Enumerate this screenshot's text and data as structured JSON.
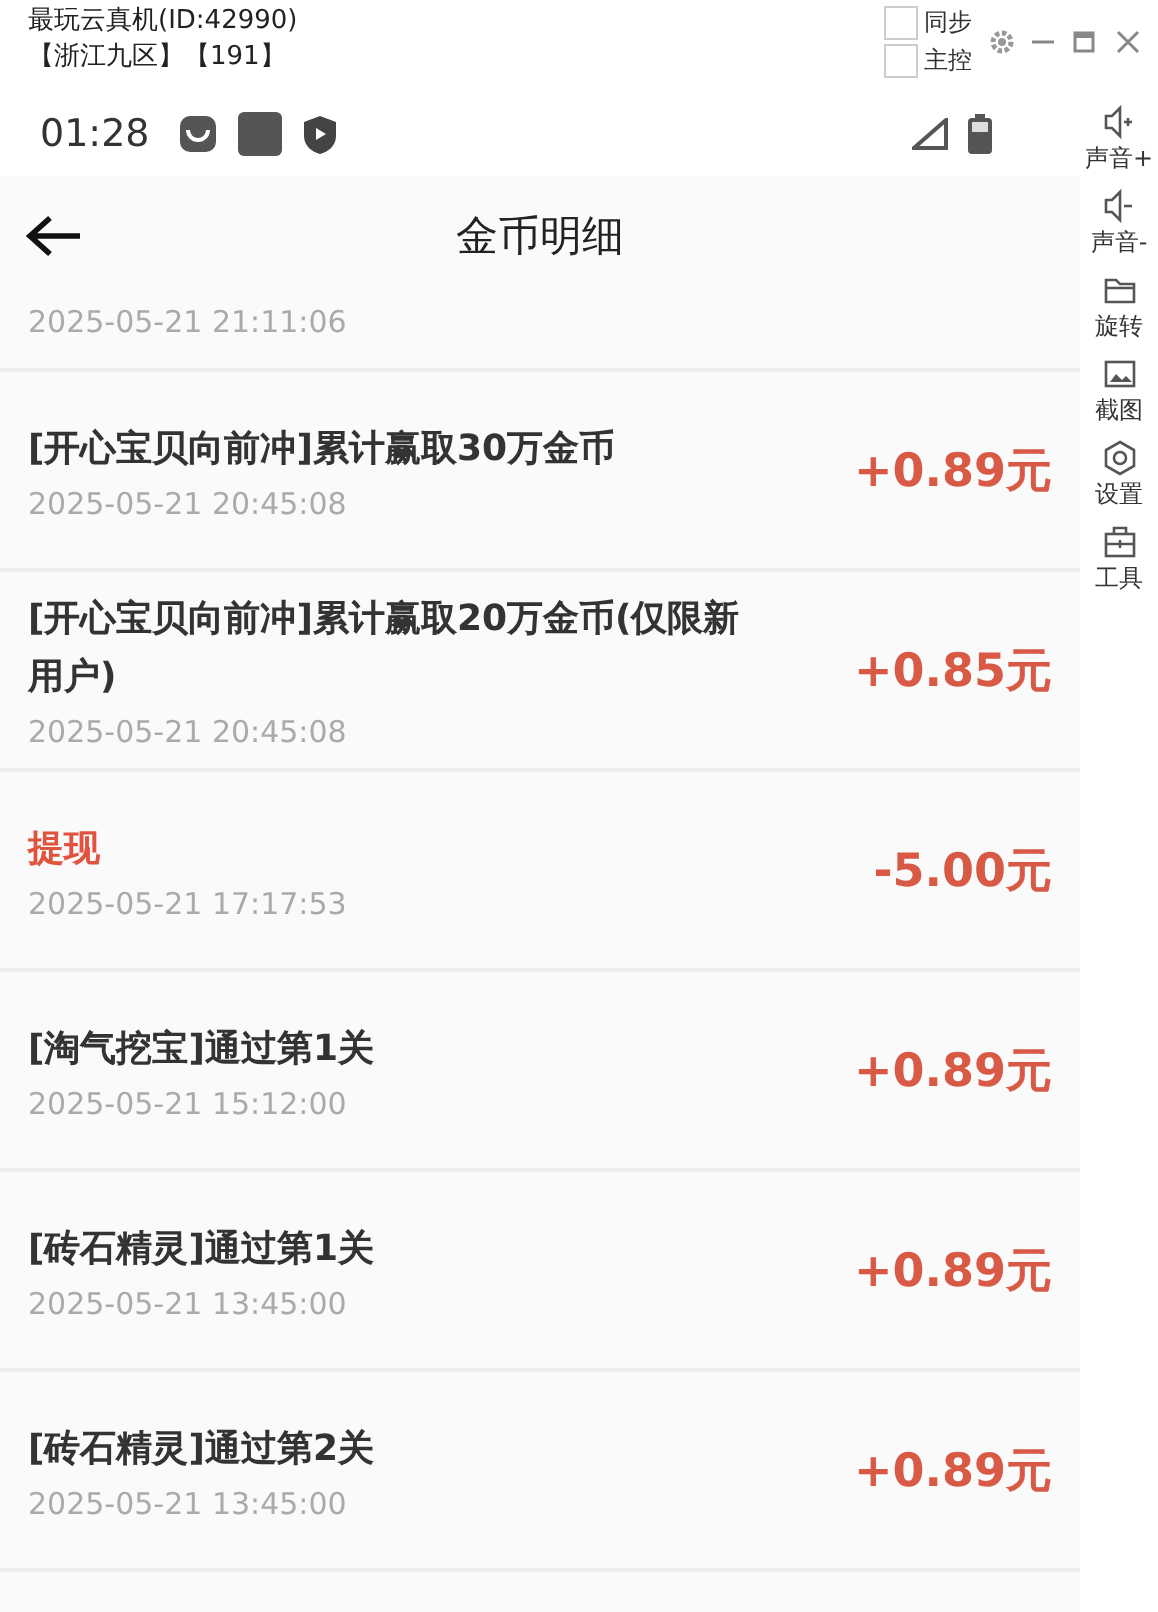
{
  "window": {
    "title": "最玩云真机(ID:42990)",
    "subtitle": "【浙江九区】【191】",
    "options": [
      {
        "label": "同步",
        "checked": false
      },
      {
        "label": "主控",
        "checked": false
      }
    ]
  },
  "status_bar": {
    "time": "01:28"
  },
  "header": {
    "title": "金币明细"
  },
  "records": [
    {
      "kind": "partial",
      "time": "2025-05-21 21:11:06"
    },
    {
      "kind": "income",
      "title": "[开心宝贝向前冲]累计赢取30万金币",
      "time": "2025-05-21 20:45:08",
      "amount": "+0.89元"
    },
    {
      "kind": "income",
      "title": "[开心宝贝向前冲]累计赢取20万金币(仅限新用户)",
      "time": "2025-05-21 20:45:08",
      "amount": "+0.85元"
    },
    {
      "kind": "withdrawal",
      "title": "提现",
      "time": "2025-05-21 17:17:53",
      "amount": "-5.00元"
    },
    {
      "kind": "income",
      "title": "[淘气挖宝]通过第1关",
      "time": "2025-05-21 15:12:00",
      "amount": "+0.89元"
    },
    {
      "kind": "income",
      "title": "[砖石精灵]通过第1关",
      "time": "2025-05-21 13:45:00",
      "amount": "+0.89元"
    },
    {
      "kind": "income",
      "title": "[砖石精灵]通过第2关",
      "time": "2025-05-21 13:45:00",
      "amount": "+0.89元"
    }
  ],
  "side_tools": [
    {
      "kind": "volume-up",
      "label": "声音+"
    },
    {
      "kind": "volume-down",
      "label": "声音-"
    },
    {
      "kind": "rotate",
      "label": "旋转"
    },
    {
      "kind": "screenshot",
      "label": "截图"
    },
    {
      "kind": "settings",
      "label": "设置"
    },
    {
      "kind": "tools",
      "label": "工具"
    }
  ]
}
